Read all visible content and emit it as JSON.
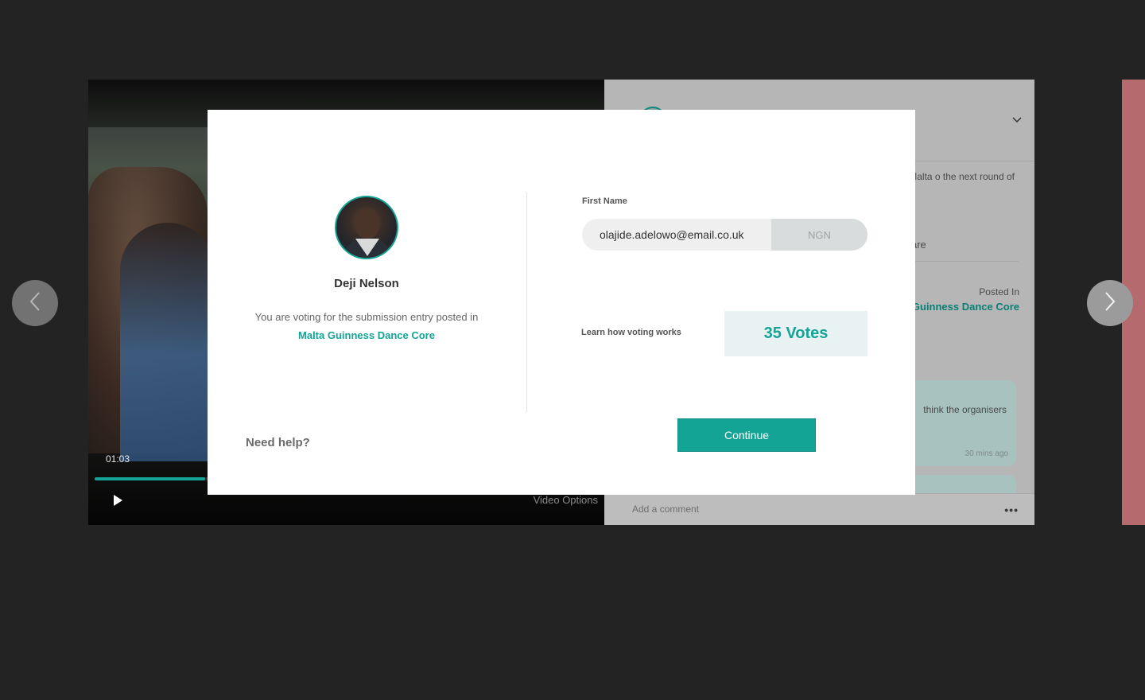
{
  "video": {
    "timestamp": "01:03",
    "progress": 0.22,
    "options_label": "Video Options"
  },
  "side_panel": {
    "description": "bmission for the Malta o the next round of",
    "share_label": "are",
    "posted_in_label": "Posted In",
    "posted_in_value": "Guinness Dance Core",
    "comment_text": "think the organisers",
    "comment_time": "30 mins ago",
    "add_comment_placeholder": "Add a comment",
    "more_label": "•••"
  },
  "modal": {
    "user_name": "Deji Nelson",
    "voting_text": "You are voting for the submission entry posted in",
    "voting_link": "Malta Guinness Dance Core",
    "help_label": "Need help?",
    "field_label": "First Name",
    "field_value": "olajide.adelowo@email.co.uk",
    "currency": "NGN",
    "learn_label": "Learn how voting works",
    "votes_label": "35 Votes",
    "continue_label": "Continue"
  },
  "icons": {
    "prev": "chevron-left-icon",
    "next": "chevron-right-icon",
    "play": "play-icon",
    "collapse": "chevron-down-icon"
  },
  "colors": {
    "accent": "#14a496",
    "backdrop": "#232323"
  }
}
